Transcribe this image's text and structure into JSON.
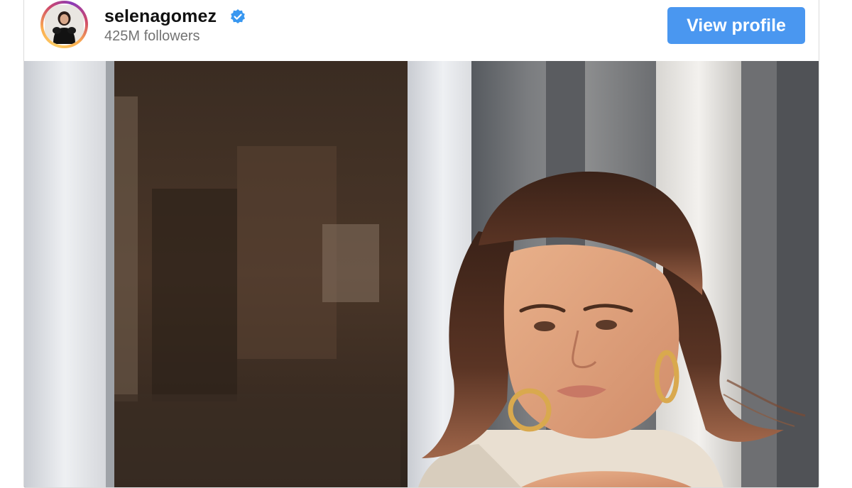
{
  "profile": {
    "username": "selenagomez",
    "followers": "425M followers",
    "verified": true,
    "view_profile_label": "View profile"
  },
  "icons": {
    "verified": "verified-badge-icon",
    "avatar": "profile-avatar"
  },
  "colors": {
    "button": "#4a97f0",
    "verified_badge": "#3897f0",
    "followers_text": "#737373"
  }
}
